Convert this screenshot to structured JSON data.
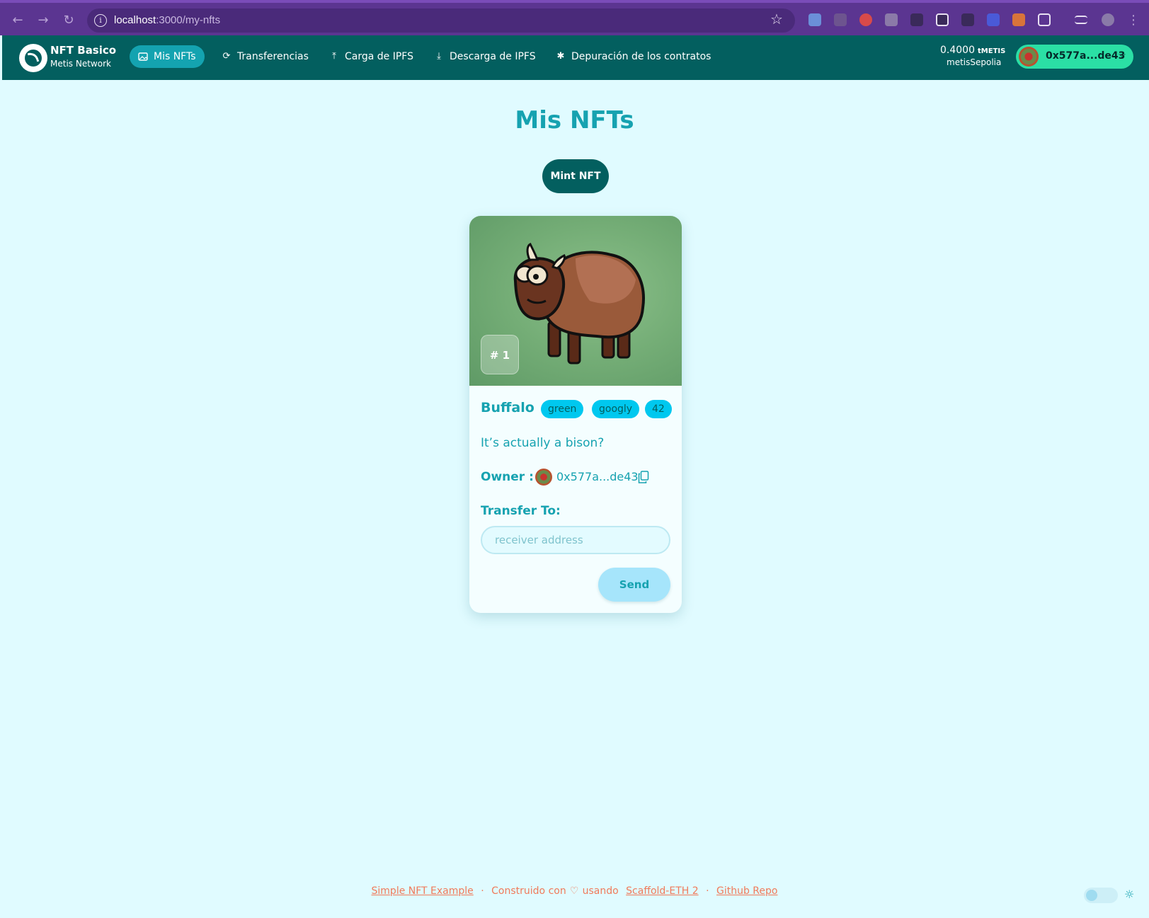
{
  "browser": {
    "url_host": "localhost",
    "url_path": ":3000/my-nfts"
  },
  "header": {
    "brand_title": "NFT Basico",
    "brand_subtitle": "Metis Network",
    "menu": [
      {
        "label": "Mis NFTs",
        "icon": "image-icon",
        "active": true
      },
      {
        "label": "Transferencias",
        "icon": "refresh-icon",
        "active": false
      },
      {
        "label": "Carga de IPFS",
        "icon": "upload-icon",
        "active": false
      },
      {
        "label": "Descarga de IPFS",
        "icon": "download-icon",
        "active": false
      },
      {
        "label": "Depuración de los contratos",
        "icon": "bug-icon",
        "active": false
      }
    ],
    "balance_amount": "0.4000",
    "balance_unit": "tMETIS",
    "network": "metisSepolia",
    "account": "0x577a...de43"
  },
  "main": {
    "title": "Mis NFTs",
    "mint_label": "Mint NFT"
  },
  "nft": {
    "token_id": "# 1",
    "name": "Buffalo",
    "tags": [
      "green",
      "googly",
      "42"
    ],
    "description": "It’s actually a bison?",
    "owner_label": "Owner :",
    "owner_address": "0x577a...de43",
    "transfer_label": "Transfer To:",
    "receiver_placeholder": "receiver address",
    "send_label": "Send"
  },
  "footer": {
    "link1": "Simple NFT Example",
    "built_with": "Construido con",
    "using": "usando",
    "link2": "Scaffold-ETH 2",
    "link3": "Github Repo"
  },
  "colors": {
    "header_bg": "#035f5f",
    "accent": "#16a2b0",
    "account_pill": "#2bdfa5",
    "page_bg": "#e0fbff",
    "footer_link": "#f07a5a"
  }
}
